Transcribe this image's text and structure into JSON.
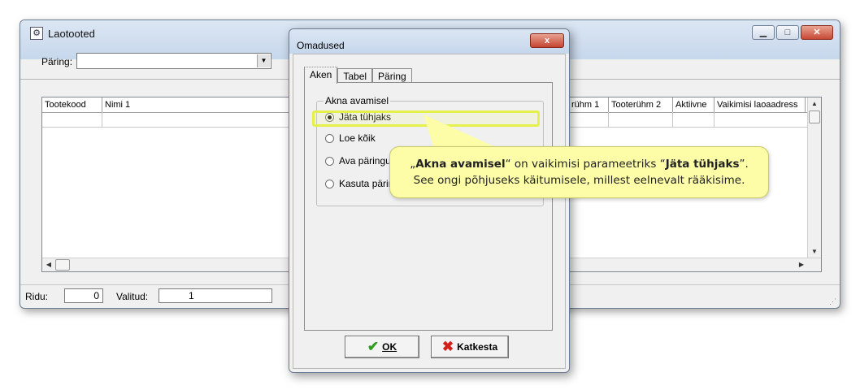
{
  "main_window": {
    "title": "Laotooted",
    "query_label": "Päring:",
    "query_value": "",
    "columns": [
      "Tootekood",
      "Nimi 1",
      "rühm 1",
      "Tooterühm 2",
      "Aktiivne",
      "Vaikimisi laoaadress"
    ],
    "status": {
      "rows_label": "Ridu:",
      "rows_value": "0",
      "selected_label": "Valitud:",
      "selected_value": "1"
    }
  },
  "dialog": {
    "title": "Omadused",
    "close_glyph": "x",
    "tabs": [
      {
        "label": "Aken",
        "active": true
      },
      {
        "label": "Tabel",
        "active": false
      },
      {
        "label": "Päring",
        "active": false
      }
    ],
    "group_label": "Akna avamisel",
    "options": [
      {
        "label": "Jäta tühjaks",
        "checked": true
      },
      {
        "label": "Loe kõik",
        "checked": false
      },
      {
        "label": "Ava päringu",
        "checked": false
      },
      {
        "label": "Kasuta pärin",
        "checked": false
      }
    ],
    "ok_label": "OK",
    "cancel_label": "Katkesta"
  },
  "callout": {
    "line1_quote_open": "„",
    "line1_bold1": "Akna avamisel",
    "line1_mid": "“ on vaikimisi parameetriks “",
    "line1_bold2": "Jäta tühjaks",
    "line1_end": "”.",
    "line2": "See ongi põhjuseks käitumisele, millest eelnevalt rääkisime."
  },
  "colors": {
    "callout_bg": "#fdfda8",
    "highlight": "#e6f04a",
    "close_red": "#c54531"
  },
  "icons": [
    "app-icon",
    "minimize-icon",
    "maximize-icon",
    "close-icon",
    "chevron-down-icon",
    "checkmark-icon",
    "cross-icon"
  ]
}
